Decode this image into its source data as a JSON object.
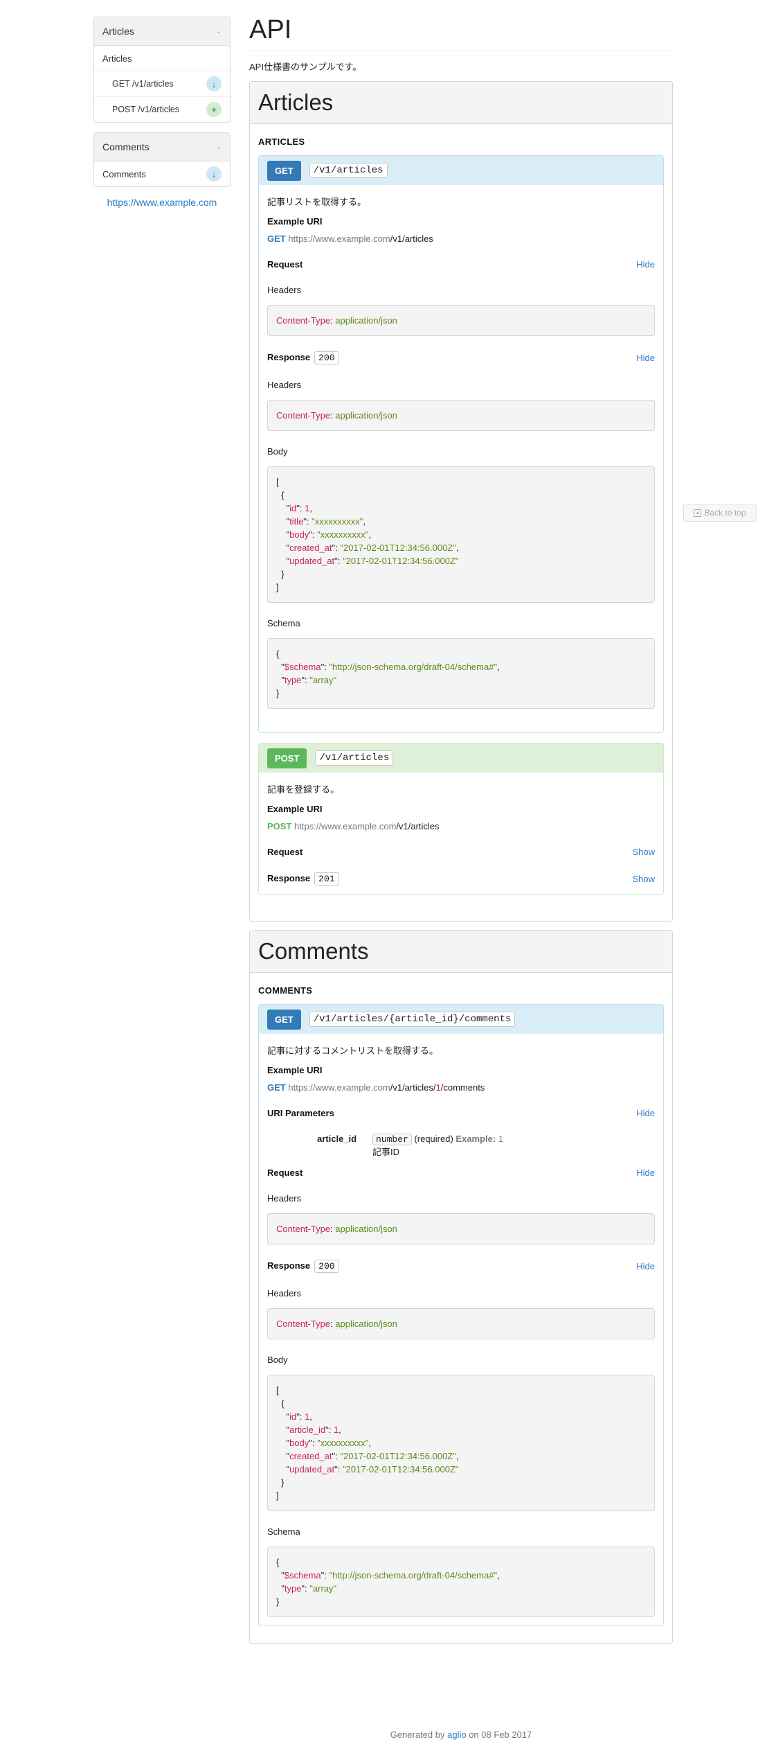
{
  "sidebar": {
    "groups": [
      {
        "title": "Articles",
        "sub": "Articles",
        "items": [
          {
            "label": "GET /v1/articles",
            "icon": "arrow-down-icon"
          },
          {
            "label": "POST /v1/articles",
            "icon": "plus-icon"
          }
        ]
      },
      {
        "title": "Comments",
        "sub": "Comments"
      }
    ],
    "link": "https://www.example.com"
  },
  "page": {
    "title": "API",
    "description": "API仕様書のサンプルです。"
  },
  "back_to_top": "Back to top",
  "common": {
    "example_uri": "Example URI",
    "request": "Request",
    "response": "Response",
    "headers": "Headers",
    "body": "Body",
    "schema": "Schema",
    "hide": "Hide",
    "show": "Show",
    "uri_params": "URI Parameters",
    "header_key": "Content-Type",
    "header_value": "application/json"
  },
  "groups": {
    "articles": {
      "title": "Articles",
      "resource": "ARTICLES",
      "get": {
        "method": "GET",
        "uri": "/v1/articles",
        "description": "記事リストを取得する。",
        "host": "https://www.example.com",
        "path": "/v1/articles",
        "status": "200",
        "body": {
          "id": "1",
          "title": "\"xxxxxxxxxx\"",
          "body": "\"xxxxxxxxxx\"",
          "created_at": "\"2017-02-01T12:34:56.000Z\"",
          "updated_at": "\"2017-02-01T12:34:56.000Z\""
        },
        "schema": {
          "schema_url": "\"http://json-schema.org/draft-04/schema#\"",
          "type": "\"array\""
        }
      },
      "post": {
        "method": "POST",
        "uri": "/v1/articles",
        "description": "記事を登録する。",
        "host": "https://www.example.com",
        "path": "/v1/articles",
        "status": "201"
      }
    },
    "comments": {
      "title": "Comments",
      "resource": "COMMENTS",
      "get": {
        "method": "GET",
        "uri": "/v1/articles/{article_id}/comments",
        "description": "記事に対するコメントリストを取得する。",
        "host": "https://www.example.com",
        "path_a": "/v1/articles/",
        "path_param": "1",
        "path_b": "/comments",
        "param": {
          "name": "article_id",
          "type": "number",
          "required": "(required)",
          "example_label": "Example:",
          "example_value": "1",
          "desc": "記事ID"
        },
        "status": "200",
        "body": {
          "id": "1",
          "article_id": "1",
          "body": "\"xxxxxxxxxx\"",
          "created_at": "\"2017-02-01T12:34:56.000Z\"",
          "updated_at": "\"2017-02-01T12:34:56.000Z\""
        },
        "schema": {
          "schema_url": "\"http://json-schema.org/draft-04/schema#\"",
          "type": "\"array\""
        }
      }
    }
  },
  "footer": {
    "prefix": "Generated by",
    "link": "aglio",
    "suffix": "on 08 Feb 2017"
  }
}
